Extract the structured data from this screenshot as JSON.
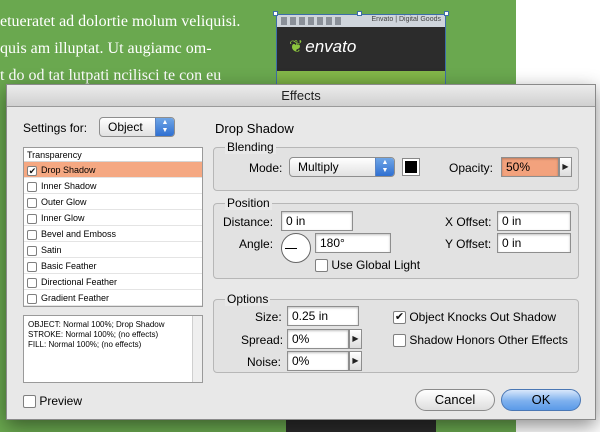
{
  "background_document": {
    "text_lines": [
      "etueratet ad dolortie molum veliquisi.",
      "quis am illuptat. Ut augiamc om-",
      "t do od tat lutpati ncilisci te con eu"
    ],
    "image_logo": "envato",
    "image_tab_text": "Envato | Digital Goods"
  },
  "dialog": {
    "title": "Effects",
    "settings_for_label": "Settings for:",
    "settings_for_value": "Object",
    "effects_list": {
      "header": "Transparency",
      "items": [
        {
          "label": "Drop Shadow",
          "checked": true,
          "selected": true
        },
        {
          "label": "Inner Shadow",
          "checked": false
        },
        {
          "label": "Outer Glow",
          "checked": false
        },
        {
          "label": "Inner Glow",
          "checked": false
        },
        {
          "label": "Bevel and Emboss",
          "checked": false
        },
        {
          "label": "Satin",
          "checked": false
        },
        {
          "label": "Basic Feather",
          "checked": false
        },
        {
          "label": "Directional Feather",
          "checked": false
        },
        {
          "label": "Gradient Feather",
          "checked": false
        }
      ]
    },
    "summary_lines": [
      "OBJECT: Normal 100%; Drop Shadow",
      "STROKE: Normal 100%; (no effects)",
      "FILL: Normal 100%; (no effects)"
    ],
    "section_title": "Drop Shadow",
    "blending": {
      "title": "Blending",
      "mode_label": "Mode:",
      "mode_value": "Multiply",
      "swatch_color": "#000000",
      "opacity_label": "Opacity:",
      "opacity_value": "50%"
    },
    "position": {
      "title": "Position",
      "distance_label": "Distance:",
      "distance_value": "0 in",
      "angle_label": "Angle:",
      "angle_value": "180°",
      "global_light_label": "Use Global Light",
      "global_light_checked": false,
      "x_offset_label": "X Offset:",
      "x_offset_value": "0 in",
      "y_offset_label": "Y Offset:",
      "y_offset_value": "0 in"
    },
    "options": {
      "title": "Options",
      "size_label": "Size:",
      "size_value": "0.25 in",
      "spread_label": "Spread:",
      "spread_value": "0%",
      "noise_label": "Noise:",
      "noise_value": "0%",
      "knocks_out_label": "Object Knocks Out Shadow",
      "knocks_out_checked": true,
      "honors_label": "Shadow Honors Other Effects",
      "honors_checked": false
    },
    "preview_label": "Preview",
    "preview_checked": false,
    "cancel_label": "Cancel",
    "ok_label": "OK"
  },
  "colors": {
    "document_green": "#6aa84f",
    "selection_highlight": "#f5a882",
    "default_button": "#5b9ae8"
  }
}
